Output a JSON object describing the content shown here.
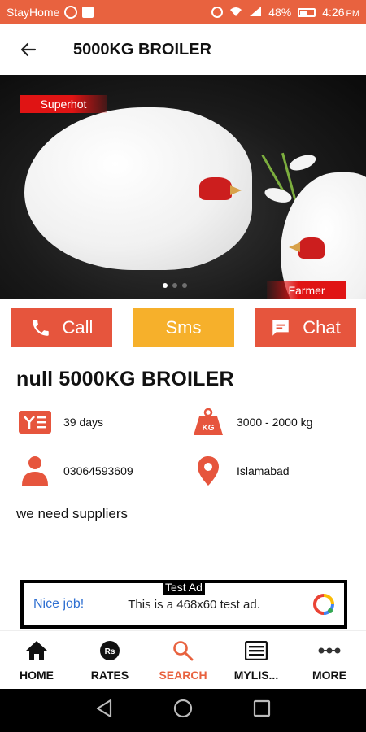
{
  "status_bar": {
    "carrier": "StayHome",
    "battery": "48%",
    "time": "4:26",
    "ampm": "PM"
  },
  "app_bar": {
    "title": "5000KG BROILER"
  },
  "hero": {
    "tag_left": "Superhot",
    "tag_right": "Farmer",
    "slide_count": 3,
    "active_slide": 1
  },
  "actions": {
    "call": "Call",
    "sms": "Sms",
    "chat": "Chat"
  },
  "listing": {
    "title": "null 5000KG BROILER",
    "age": "39 days",
    "weight": "3000 - 2000 kg",
    "phone": "03064593609",
    "location": "Islamabad",
    "description": "we need suppliers"
  },
  "ad": {
    "label": "Test Ad",
    "headline": "Nice job!",
    "body": "This is a 468x60 test ad."
  },
  "bottom_nav": [
    {
      "label": "HOME"
    },
    {
      "label": "RATES"
    },
    {
      "label": "SEARCH"
    },
    {
      "label": "MYLIS..."
    },
    {
      "label": "MORE"
    }
  ],
  "colors": {
    "primary": "#e8623f",
    "accent_red": "#e6553d",
    "sms_yellow": "#f6b02b",
    "ad_blue": "#2e6fd1"
  }
}
